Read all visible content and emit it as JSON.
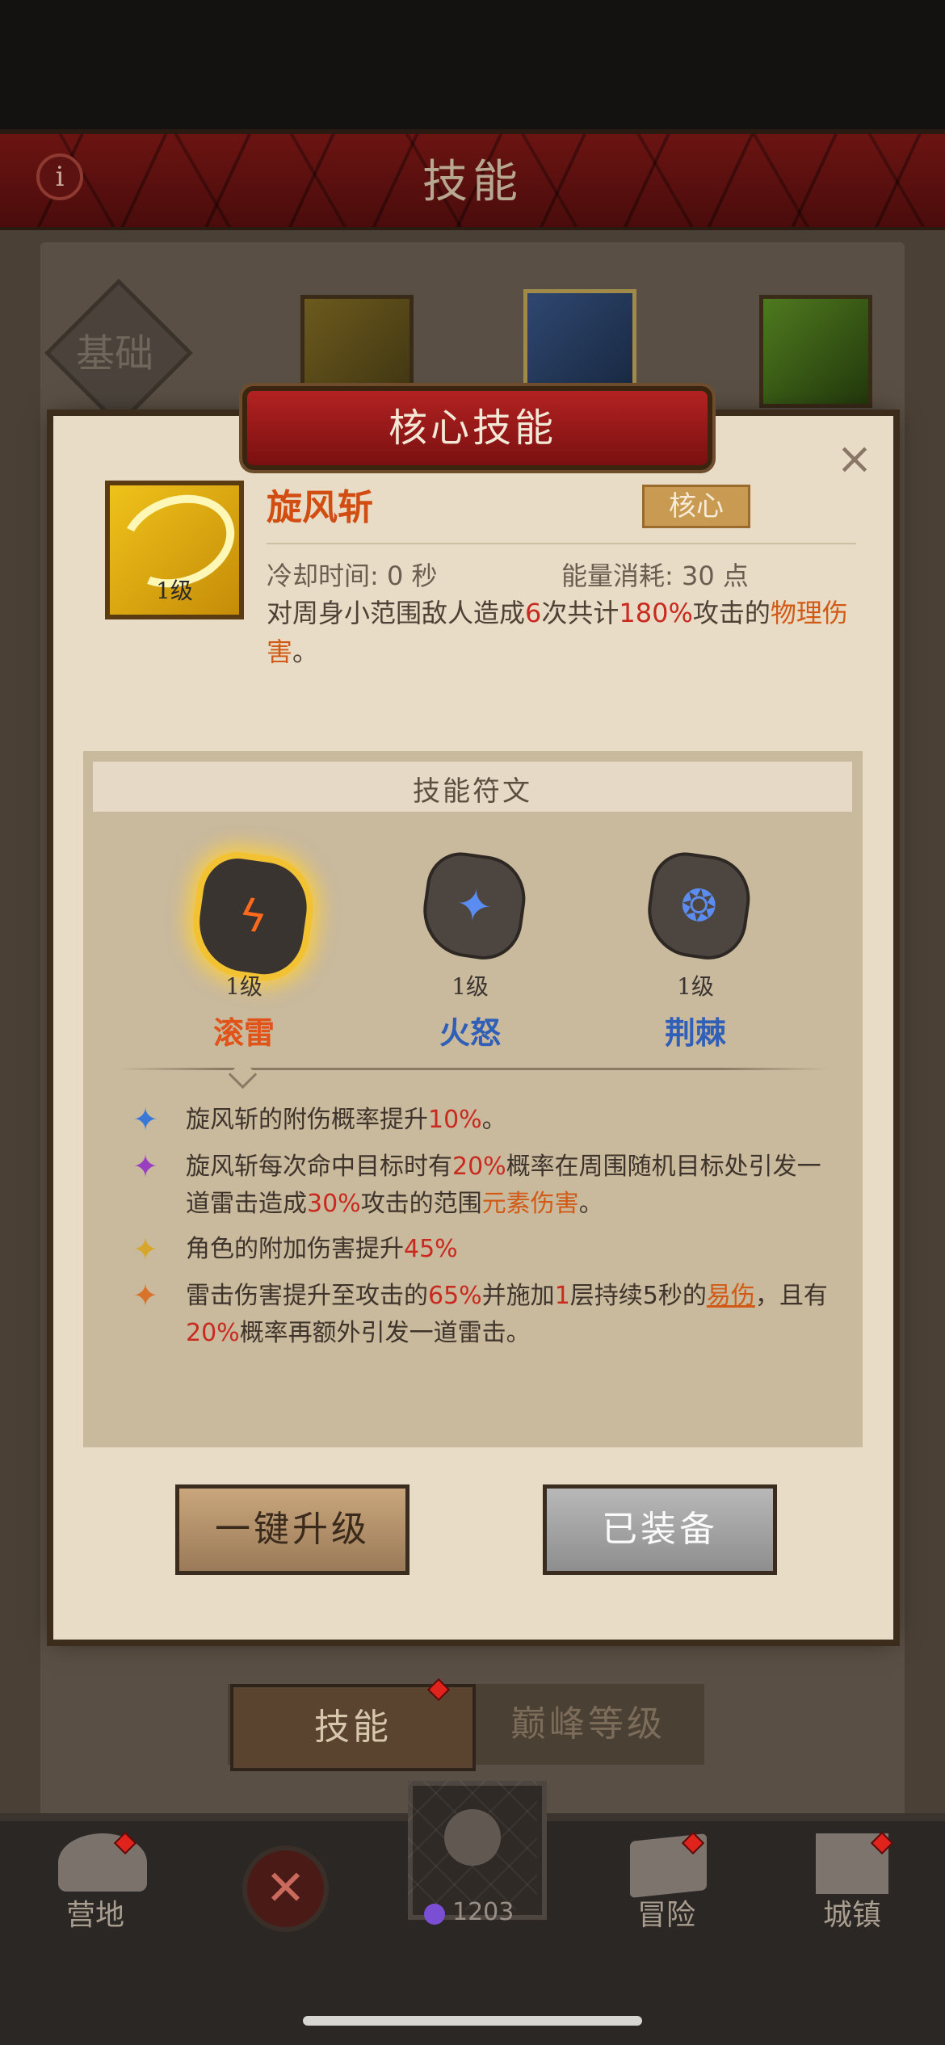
{
  "header": {
    "title": "技能"
  },
  "category_tab": {
    "label": "基础"
  },
  "modal": {
    "title": "核心技能",
    "close_symbol": "×",
    "skill": {
      "name": "旋风斩",
      "level": "1级",
      "type_badge": "核心",
      "cooldown": "冷却时间: 0 秒",
      "energy": "能量消耗: 30 点",
      "description": {
        "p1": "对周身小范围敌人造成",
        "hits": "6",
        "p2": "次共计",
        "percent": "180%",
        "p3": "攻击的",
        "dmg_type": "物理伤害",
        "p4": "。"
      }
    },
    "runes": {
      "header": "技能符文",
      "items": [
        {
          "level": "1级",
          "name": "滚雷",
          "color": "#e0541a",
          "selected": true
        },
        {
          "level": "1级",
          "name": "火怒",
          "color": "#2f5fb6",
          "selected": false
        },
        {
          "level": "1级",
          "name": "荆棘",
          "color": "#2f5fb6",
          "selected": false
        }
      ],
      "effects": [
        {
          "icon": "blue-star-icon",
          "color": "#3a78d8",
          "a": "旋风斩的附伤概率提升",
          "b": "10%",
          "c": "。"
        },
        {
          "icon": "purple-star-icon",
          "color": "#9a3fc0",
          "a": "旋风斩每次命中目标时有",
          "b": "20%",
          "c": "概率在周围随机目标处引发一道雷击造成",
          "d": "30%",
          "e": "攻击的范围",
          "f": "元素伤害",
          "g": "。"
        },
        {
          "icon": "yellow-star-icon",
          "color": "#d8a62a",
          "a": "角色的附加伤害提升",
          "b": "45%"
        },
        {
          "icon": "orange-star-icon",
          "color": "#d9722a",
          "a": "雷击伤害提升至攻击的",
          "b": "65%",
          "c": "并施加",
          "d": "1",
          "e": "层持续",
          "f": "5",
          "g": "秒的",
          "h": "易伤",
          "i": "，且有",
          "j": "20%",
          "k": "概率再额外引发一道雷击。"
        }
      ]
    },
    "buttons": {
      "upgrade": "一键升级",
      "equipped": "已装备"
    }
  },
  "bottom_tabs": {
    "skill": "技能",
    "peak": "巅峰等级"
  },
  "nav": {
    "camp": "营地",
    "adventure": "冒险",
    "town": "城镇",
    "currency": "1203"
  }
}
